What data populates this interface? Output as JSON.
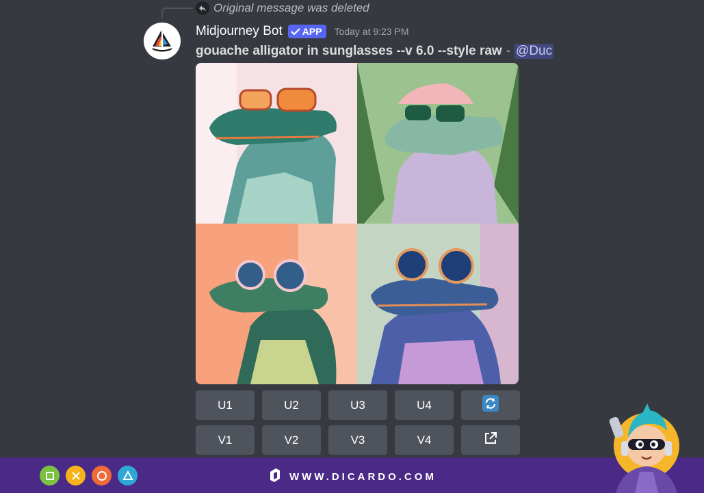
{
  "reply": {
    "text": "Original message was deleted",
    "icon": "reply-arrow-icon"
  },
  "message": {
    "author": "Midjourney Bot",
    "badge_label": "APP",
    "badge_icon": "checkmark-icon",
    "timestamp": "Today at 9:23 PM",
    "prompt": "gouache alligator in sunglasses --v 6.0 --style raw",
    "separator": "-",
    "mention": "@Duc"
  },
  "image_grid": {
    "tiles": [
      {
        "subject": "alligator with orange sunglasses",
        "background": "#f6e2e4"
      },
      {
        "subject": "alligator with pink hat and sunglasses",
        "background": "#9cc38f"
      },
      {
        "subject": "alligator with pink round sunglasses",
        "background": "#f7a17d"
      },
      {
        "subject": "alligator with blue sunglasses",
        "background": "#c4d5c4"
      }
    ]
  },
  "buttons": {
    "upscale": [
      "U1",
      "U2",
      "U3",
      "U4"
    ],
    "variation": [
      "V1",
      "V2",
      "V3",
      "V4"
    ],
    "reroll_icon": "refresh-icon",
    "open_icon": "external-link-icon"
  },
  "bottom_bar": {
    "brand_text": "WWW.DICARDO.COM",
    "brand_icon": "dicardo-logo-icon",
    "controller_icons": [
      "square-icon",
      "cross-icon",
      "circle-icon",
      "triangle-icon"
    ],
    "controller_colors": [
      "#7cc242",
      "#f5b21a",
      "#f06a3a",
      "#2ea8d8"
    ],
    "bar_color": "#4a2a86"
  },
  "colors": {
    "background": "#36393f",
    "accent": "#5865f2",
    "button": "#4f545c"
  }
}
